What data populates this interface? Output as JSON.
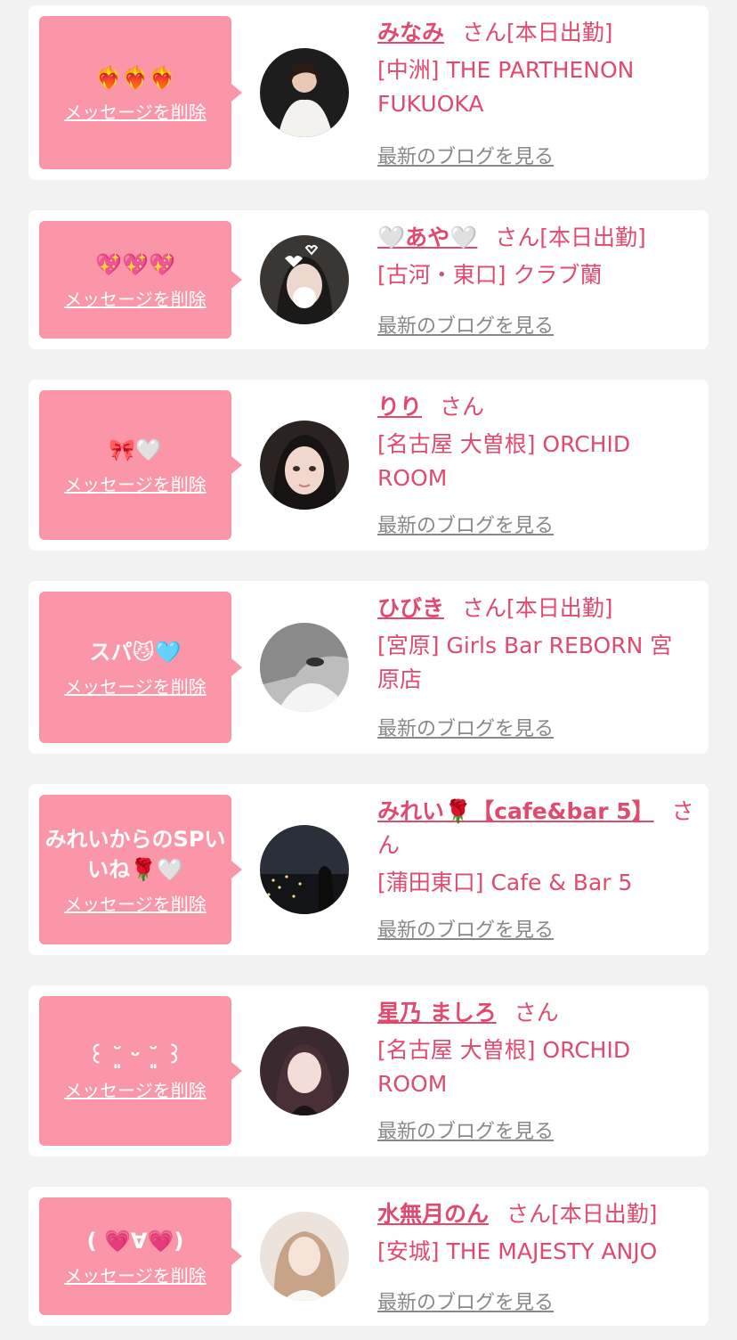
{
  "colors": {
    "bubble": "#fb96a9",
    "accent": "#e04a6e",
    "muted": "#888888",
    "background": "#f2f2f2"
  },
  "delete_label": "メッセージを削除",
  "blog_label": "最新のブログを見る",
  "items": [
    {
      "message": "❤️‍🔥❤️‍🔥❤️‍🔥",
      "name": "みなみ",
      "san": "さん",
      "status": "[本日出勤]",
      "shop": "[中洲] THE PARTHENON FUKUOKA"
    },
    {
      "message": "💖💖💖",
      "name": "🤍あや🤍",
      "san": "さん",
      "status": "[本日出勤]",
      "shop": "[古河・東口] クラブ蘭"
    },
    {
      "message": "🎀🤍",
      "name": "りり",
      "san": "さん",
      "status": "",
      "shop": "[名古屋 大曽根] ORCHID ROOM"
    },
    {
      "message": "スパ😼🩵",
      "name": "ひびき",
      "san": "さん",
      "status": "[本日出勤]",
      "shop": "[宮原] Girls Bar REBORN 宮原店"
    },
    {
      "message": "みれいからのSPいいね🌹🤍",
      "name": "みれい🌹【cafe&bar 5】",
      "san": "さん",
      "status": "",
      "shop": "[蒲田東口] Cafe & Bar 5"
    },
    {
      "message": "꒰ ˘͈ ᵕ ˘͈ ꒱",
      "name": "星乃 ましろ",
      "san": "さん",
      "status": "",
      "shop": "[名古屋 大曽根] ORCHID ROOM"
    },
    {
      "message": "( 💗∀💗)",
      "name": "水無月のん",
      "san": "さん",
      "status": "[本日出勤]",
      "shop": "[安城] THE MAJESTY ANJO"
    }
  ]
}
